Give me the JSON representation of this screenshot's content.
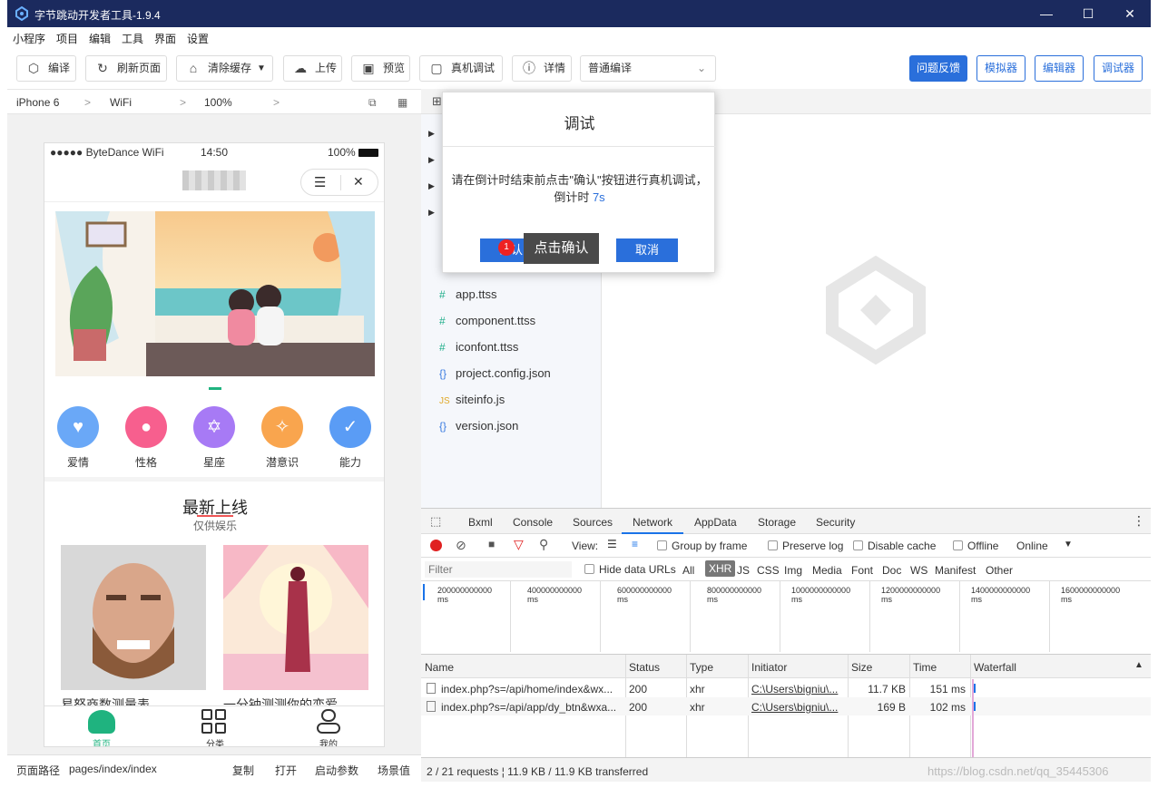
{
  "window": {
    "title": "字节跳动开发者工具-1.9.4",
    "minimize": "—",
    "maximize": "☐",
    "close": "✕"
  },
  "menu": [
    "小程序",
    "项目",
    "编辑",
    "工具",
    "界面",
    "设置"
  ],
  "toolbar": {
    "compile": "编译",
    "refresh": "刷新页面",
    "clear_cache": "清除缓存",
    "upload": "上传",
    "preview": "预览",
    "remote_debug": "真机调试",
    "details": "详情",
    "compile_mode": "普通编译",
    "feedback": "问题反馈",
    "simulator": "模拟器",
    "editor": "编辑器",
    "debugger": "调试器"
  },
  "device": {
    "model": "iPhone 6",
    "network": "WiFi",
    "zoom": "100%"
  },
  "phone": {
    "carrier": "●●●●● ByteDance WiFi",
    "time": "14:50",
    "battery": "100%",
    "categories": [
      {
        "label": "爱情",
        "color": "#6aa8f7",
        "icon": "heart-icon",
        "glyph": "♥"
      },
      {
        "label": "性格",
        "color": "#f75f8e",
        "icon": "chat-icon",
        "glyph": "●"
      },
      {
        "label": "星座",
        "color": "#a77af5",
        "icon": "star-of-david-icon",
        "glyph": "✡"
      },
      {
        "label": "潜意识",
        "color": "#f9a54e",
        "icon": "lightbulb-icon",
        "glyph": "✧"
      },
      {
        "label": "能力",
        "color": "#5a9cf5",
        "icon": "thumbs-up-icon",
        "glyph": "✓"
      }
    ],
    "section_title": "最新上线",
    "section_sub": "仅供娱乐",
    "card1_title": "易怒商数测量表",
    "card2_title": "一分钟测测你的恋爱",
    "tabs": [
      "首页",
      "分类",
      "我的"
    ]
  },
  "bottom": {
    "path_label": "页面路径",
    "path": "pages/index/index",
    "copy": "复制",
    "open": "打开",
    "params": "启动参数",
    "scene": "场景值"
  },
  "files": [
    {
      "icon": "#",
      "name": "app.ttss"
    },
    {
      "icon": "#",
      "name": "component.ttss"
    },
    {
      "icon": "#",
      "name": "iconfont.ttss"
    },
    {
      "icon": "{}",
      "name": "project.config.json"
    },
    {
      "icon": "JS",
      "name": "siteinfo.js"
    },
    {
      "icon": "{}",
      "name": "version.json"
    }
  ],
  "dialog": {
    "title": "调试",
    "message": "请在倒计时结束前点击\"确认\"按钮进行真机调试，倒计时",
    "countdown": "7s",
    "confirm": "确认",
    "cancel": "取消",
    "tooltip": "点击确认",
    "badge": "1"
  },
  "devtools": {
    "tabs": [
      "Bxml",
      "Console",
      "Sources",
      "Network",
      "AppData",
      "Storage",
      "Security"
    ],
    "view_label": "View:",
    "group_by_frame": "Group by frame",
    "preserve_log": "Preserve log",
    "disable_cache": "Disable cache",
    "offline": "Offline",
    "online": "Online",
    "filter_placeholder": "Filter",
    "hide_data_urls": "Hide data URLs",
    "filter_types": [
      "All",
      "XHR",
      "JS",
      "CSS",
      "Img",
      "Media",
      "Font",
      "Doc",
      "WS",
      "Manifest",
      "Other"
    ],
    "timeline": [
      "200000000000 ms",
      "400000000000 ms",
      "600000000000 ms",
      "800000000000 ms",
      "1000000000000 ms",
      "1200000000000 ms",
      "1400000000000 ms",
      "1600000000000 ms"
    ],
    "columns": [
      "Name",
      "Status",
      "Type",
      "Initiator",
      "Size",
      "Time",
      "Waterfall"
    ],
    "rows": [
      {
        "name": "index.php?s=/api/home/index&wx...",
        "status": "200",
        "type": "xhr",
        "initiator": "C:\\Users\\bigniu\\...",
        "size": "11.7 KB",
        "time": "151 ms"
      },
      {
        "name": "index.php?s=/api/app/dy_btn&wxa...",
        "status": "200",
        "type": "xhr",
        "initiator": "C:\\Users\\bigniu\\...",
        "size": "169 B",
        "time": "102 ms"
      }
    ],
    "summary": "2 / 21 requests  ¦  11.9 KB / 11.9 KB transferred"
  },
  "watermark": "https://blog.csdn.net/qq_35445306"
}
